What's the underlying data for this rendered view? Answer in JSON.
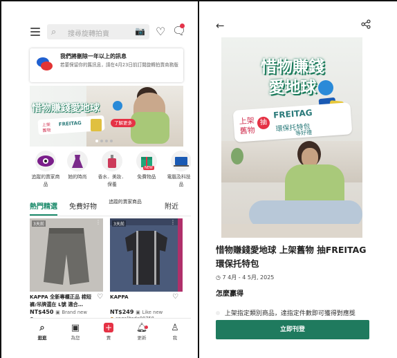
{
  "left": {
    "search": {
      "placeholder": "搜尋旋轉拍賣"
    },
    "notice": {
      "title": "我們將刪除一年以上的訊息",
      "body": "若要保留你的舊訊息，請在4月23日前訂閱旋轉拍賣商務版"
    },
    "banner": {
      "title": "惜物賺錢愛地球",
      "line1": "上架",
      "line2": "舊物",
      "brand": "FREITAG",
      "more_button": "了解更多"
    },
    "categories": [
      {
        "label": "追蹤的賣家商品",
        "icon": "eye-icon"
      },
      {
        "label": "她的時尚",
        "icon": "dress-icon"
      },
      {
        "label": "香水．美妝．保養",
        "icon": "perfume-icon"
      },
      {
        "label": "免費物品",
        "icon": "gift-icon",
        "badge": "NEW"
      },
      {
        "label": "電腦及科技產品",
        "icon": "laptop-icon"
      }
    ],
    "tabs": [
      "熱門精選",
      "免費好物",
      "追蹤的賣家商品",
      "附近"
    ],
    "cards": [
      {
        "age": "3天前",
        "name": "KAPPA 全新專櫃正品 棉短褲/吊牌還在 L號 適合…",
        "price": "NT$450",
        "condition": "Brand new",
        "seller": "",
        "color": "#6b6a66"
      },
      {
        "age": "3天前",
        "name": "KAPPA",
        "price": "NT$249",
        "condition": "Like new",
        "seller": "angelitode98758",
        "color": "#2a2a2e"
      }
    ],
    "nav": [
      {
        "label": "逛逛",
        "icon": "search-icon"
      },
      {
        "label": "為您",
        "icon": "for-you-icon"
      },
      {
        "label": "賣",
        "icon": "sell-icon"
      },
      {
        "label": "更新",
        "icon": "bell-icon"
      },
      {
        "label": "我",
        "icon": "profile-icon"
      }
    ],
    "colors": {
      "accent": "#1a8a6a",
      "red": "#e53245"
    }
  },
  "right": {
    "hero": {
      "title_line1": "惜物賺錢",
      "title_line2": "愛地球",
      "line1": "上架",
      "line2": "舊物",
      "draw": "抽",
      "brand": "FREITAG",
      "gift": "環保托特包",
      "gift2": "等好禮"
    },
    "title": "惜物賺錢愛地球 上架舊物 抽FREITAG環保托特包",
    "date": "7 4月 - 4 5月, 2025",
    "subtitle": "怎麼贏得",
    "body": "上架指定類別商品，達指定件數即可獲得對應獎",
    "cta": "立即刊登",
    "colors": {
      "cta": "#1f7a5e"
    }
  }
}
